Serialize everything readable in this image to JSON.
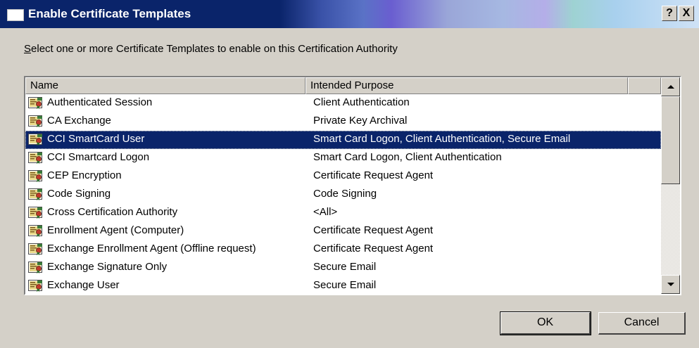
{
  "window": {
    "title": "Enable Certificate Templates",
    "help_glyph": "?",
    "close_glyph": "X"
  },
  "prompt": {
    "mnemonic": "S",
    "rest": "elect one or more Certificate Templates to enable on this Certification Authority"
  },
  "list": {
    "columns": [
      "Name",
      "Intended Purpose"
    ],
    "item_icon": "certificate-template-icon",
    "selected_index": 2,
    "rows": [
      {
        "name": "Authenticated Session",
        "purpose": "Client Authentication"
      },
      {
        "name": "CA Exchange",
        "purpose": "Private Key Archival"
      },
      {
        "name": "CCI SmartCard User",
        "purpose": "Smart Card Logon, Client Authentication, Secure Email"
      },
      {
        "name": "CCI Smartcard Logon",
        "purpose": "Smart Card Logon, Client Authentication"
      },
      {
        "name": "CEP Encryption",
        "purpose": "Certificate Request Agent"
      },
      {
        "name": "Code Signing",
        "purpose": "Code Signing"
      },
      {
        "name": "Cross Certification Authority",
        "purpose": "<All>"
      },
      {
        "name": "Enrollment Agent (Computer)",
        "purpose": "Certificate Request Agent"
      },
      {
        "name": "Exchange Enrollment Agent (Offline request)",
        "purpose": "Certificate Request Agent"
      },
      {
        "name": "Exchange Signature Only",
        "purpose": "Secure Email"
      },
      {
        "name": "Exchange User",
        "purpose": "Secure Email"
      }
    ]
  },
  "buttons": {
    "ok": "OK",
    "cancel": "Cancel"
  },
  "colors": {
    "selection": "#0a246a",
    "dialog_face": "#d4d0c8"
  }
}
